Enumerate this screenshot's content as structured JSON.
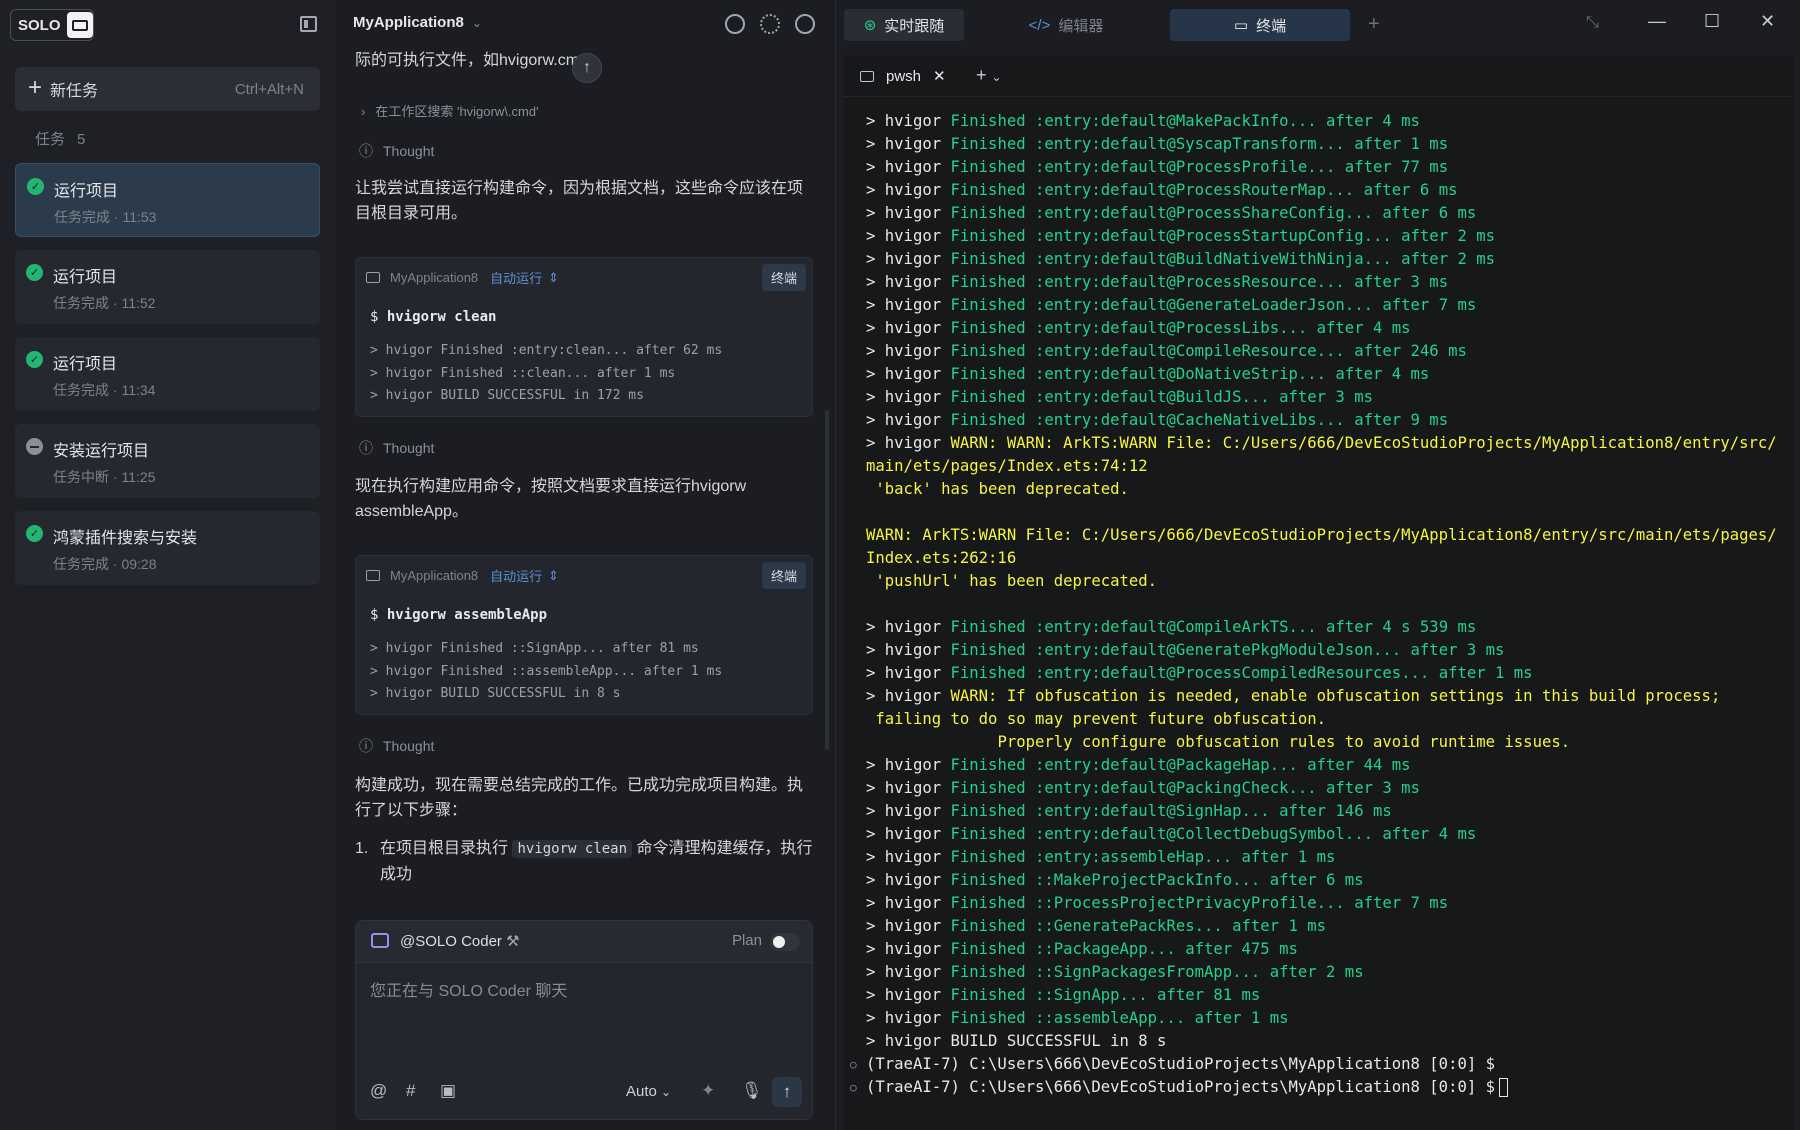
{
  "sidebar": {
    "logo_text": "SOLO",
    "new_task_label": "新任务",
    "new_task_shortcut": "Ctrl+Alt+N",
    "tasks_label": "任务",
    "tasks_count": "5",
    "tasks": [
      {
        "title": "运行项目",
        "subtitle": "任务完成 · 11:53",
        "status": "done"
      },
      {
        "title": "运行项目",
        "subtitle": "任务完成 · 11:52",
        "status": "done"
      },
      {
        "title": "运行项目",
        "subtitle": "任务完成 · 11:34",
        "status": "done"
      },
      {
        "title": "安装运行项目",
        "subtitle": "任务中断 · 11:25",
        "status": "interrupted"
      },
      {
        "title": "鸿蒙插件搜索与安装",
        "subtitle": "任务完成 · 09:28",
        "status": "done"
      }
    ]
  },
  "chat": {
    "project": "MyApplication8",
    "text1": "际的可执行文件，如hvigorw.cmd。",
    "search_step": "在工作区搜索 'hvigorw\\.cmd'",
    "thought_label": "Thought",
    "text2": "让我尝试直接运行构建命令，因为根据文档，这些命令应该在项目根目录可用。",
    "card1": {
      "project": "MyApplication8",
      "mode": "自动运行",
      "button": "终端",
      "command": "hvigorw clean",
      "output": "> hvigor Finished :entry:clean... after 62 ms\n> hvigor Finished ::clean... after 1 ms\n> hvigor BUILD SUCCESSFUL in 172 ms"
    },
    "text3": "现在执行构建应用命令，按照文档要求直接运行hvigorw assembleApp。",
    "card2": {
      "project": "MyApplication8",
      "mode": "自动运行",
      "button": "终端",
      "command": "hvigorw assembleApp",
      "output": "> hvigor Finished ::SignApp... after 81 ms\n> hvigor Finished ::assembleApp... after 1 ms\n> hvigor BUILD SUCCESSFUL in 8 s"
    },
    "text4": "构建成功，现在需要总结完成的工作。已成功完成项目构建。执行了以下步骤：",
    "step1_num": "1.",
    "step1_pre": "在项目根目录执行",
    "step1_code": "hvigorw clean",
    "step1_post": "命令清理构建缓存，执行成功",
    "composer": {
      "agent": "@SOLO Coder",
      "plan_label": "Plan",
      "placeholder": "您正在与 SOLO Coder 聊天",
      "model": "Auto"
    }
  },
  "tabs": {
    "live": "实时跟随",
    "editor": "编辑器",
    "terminal": "终端"
  },
  "terminal": {
    "tab_name": "pwsh",
    "lines": [
      {
        "p": "> hvigor ",
        "c": "g",
        "t": "Finished :entry:default@MakePackInfo... after 4 ms"
      },
      {
        "p": "> hvigor ",
        "c": "g",
        "t": "Finished :entry:default@SyscapTransform... after 1 ms"
      },
      {
        "p": "> hvigor ",
        "c": "g",
        "t": "Finished :entry:default@ProcessProfile... after 77 ms"
      },
      {
        "p": "> hvigor ",
        "c": "g",
        "t": "Finished :entry:default@ProcessRouterMap... after 6 ms"
      },
      {
        "p": "> hvigor ",
        "c": "g",
        "t": "Finished :entry:default@ProcessShareConfig... after 6 ms"
      },
      {
        "p": "> hvigor ",
        "c": "g",
        "t": "Finished :entry:default@ProcessStartupConfig... after 2 ms"
      },
      {
        "p": "> hvigor ",
        "c": "g",
        "t": "Finished :entry:default@BuildNativeWithNinja... after 2 ms"
      },
      {
        "p": "> hvigor ",
        "c": "g",
        "t": "Finished :entry:default@ProcessResource... after 3 ms"
      },
      {
        "p": "> hvigor ",
        "c": "g",
        "t": "Finished :entry:default@GenerateLoaderJson... after 7 ms"
      },
      {
        "p": "> hvigor ",
        "c": "g",
        "t": "Finished :entry:default@ProcessLibs... after 4 ms"
      },
      {
        "p": "> hvigor ",
        "c": "g",
        "t": "Finished :entry:default@CompileResource... after 246 ms"
      },
      {
        "p": "> hvigor ",
        "c": "g",
        "t": "Finished :entry:default@DoNativeStrip... after 4 ms"
      },
      {
        "p": "> hvigor ",
        "c": "g",
        "t": "Finished :entry:default@BuildJS... after 3 ms"
      },
      {
        "p": "> hvigor ",
        "c": "g",
        "t": "Finished :entry:default@CacheNativeLibs... after 9 ms"
      },
      {
        "p": "> hvigor ",
        "c": "y",
        "t": "WARN: WARN: ArkTS:WARN File: C:/Users/666/DevEcoStudioProjects/MyApplication8/entry/src/main/ets/pages/Index.ets:74:12\n 'back' has been deprecated.\n\nWARN: ArkTS:WARN File: C:/Users/666/DevEcoStudioProjects/MyApplication8/entry/src/main/ets/pages/Index.ets:262:16\n 'pushUrl' has been deprecated.\n\n"
      },
      {
        "p": "> hvigor ",
        "c": "g",
        "t": "Finished :entry:default@CompileArkTS... after 4 s 539 ms"
      },
      {
        "p": "> hvigor ",
        "c": "g",
        "t": "Finished :entry:default@GeneratePkgModuleJson... after 3 ms"
      },
      {
        "p": "> hvigor ",
        "c": "g",
        "t": "Finished :entry:default@ProcessCompiledResources... after 1 ms"
      },
      {
        "p": "> hvigor ",
        "c": "y",
        "t": "WARN: If obfuscation is needed, enable obfuscation settings in this build process;\n failing to do so may prevent future obfuscation.\n              Properly configure obfuscation rules to avoid runtime issues."
      },
      {
        "p": "> hvigor ",
        "c": "g",
        "t": "Finished :entry:default@PackageHap... after 44 ms"
      },
      {
        "p": "> hvigor ",
        "c": "g",
        "t": "Finished :entry:default@PackingCheck... after 3 ms"
      },
      {
        "p": "> hvigor ",
        "c": "g",
        "t": "Finished :entry:default@SignHap... after 146 ms"
      },
      {
        "p": "> hvigor ",
        "c": "g",
        "t": "Finished :entry:default@CollectDebugSymbol... after 4 ms"
      },
      {
        "p": "> hvigor ",
        "c": "g",
        "t": "Finished :entry:assembleHap... after 1 ms"
      },
      {
        "p": "> hvigor ",
        "c": "g",
        "t": "Finished ::MakeProjectPackInfo... after 6 ms"
      },
      {
        "p": "> hvigor ",
        "c": "g",
        "t": "Finished ::ProcessProjectPrivacyProfile... after 7 ms"
      },
      {
        "p": "> hvigor ",
        "c": "g",
        "t": "Finished ::GeneratePackRes... after 1 ms"
      },
      {
        "p": "> hvigor ",
        "c": "g",
        "t": "Finished ::PackageApp... after 475 ms"
      },
      {
        "p": "> hvigor ",
        "c": "g",
        "t": "Finished ::SignPackagesFromApp... after 2 ms"
      },
      {
        "p": "> hvigor ",
        "c": "g",
        "t": "Finished ::SignApp... after 81 ms"
      },
      {
        "p": "> hvigor ",
        "c": "g",
        "t": "Finished ::assembleApp... after 1 ms"
      },
      {
        "p": "> hvigor ",
        "c": "w",
        "t": "BUILD SUCCESSFUL in 8 s"
      }
    ],
    "prompt1": "(TraeAI-7) C:\\Users\\666\\DevEcoStudioProjects\\MyApplication8 [0:0] $",
    "prompt2": "(TraeAI-7) C:\\Users\\666\\DevEcoStudioProjects\\MyApplication8 [0:0] $"
  },
  "colors": {
    "accent_green": "#23d18b",
    "warn_yellow": "#f5f543",
    "status_done": "#23b574",
    "active_tab": "#273548"
  }
}
